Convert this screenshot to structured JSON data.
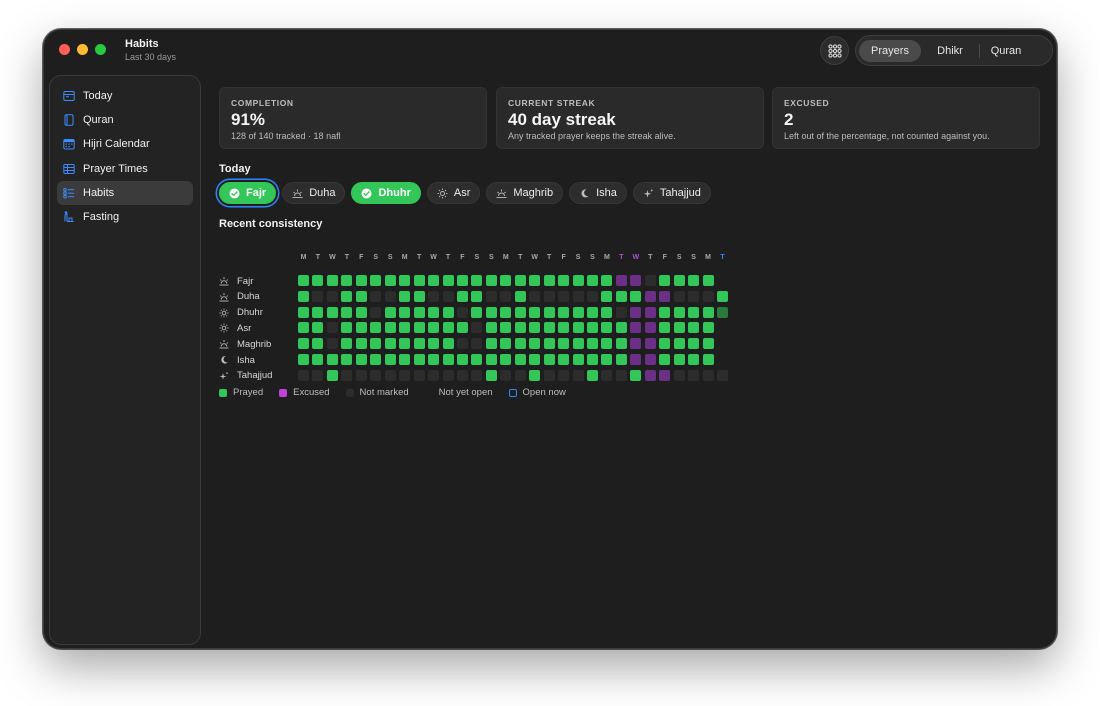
{
  "app": {
    "title": "Habits",
    "subtitle": "Last 30 days"
  },
  "segmented": {
    "items": [
      "Prayers",
      "Dhikr",
      "Quran"
    ],
    "active": "Prayers"
  },
  "sidebar": {
    "items": [
      {
        "label": "Today",
        "icon": "today-icon"
      },
      {
        "label": "Quran",
        "icon": "book-icon"
      },
      {
        "label": "Hijri Calendar",
        "icon": "calendar-icon"
      },
      {
        "label": "Prayer Times",
        "icon": "table-icon"
      },
      {
        "label": "Habits",
        "icon": "checklist-icon",
        "active": true
      },
      {
        "label": "Fasting",
        "icon": "fasting-icon"
      }
    ]
  },
  "cards": [
    {
      "label": "COMPLETION",
      "value": "91%",
      "note": "128 of 140 tracked · 18 nafl"
    },
    {
      "label": "CURRENT STREAK",
      "value": "40 day streak",
      "note": "Any tracked prayer keeps the streak alive."
    },
    {
      "label": "EXCUSED",
      "value": "2",
      "note": "Left out of the percentage, not counted against you."
    }
  ],
  "today": {
    "title": "Today",
    "chips": [
      {
        "label": "Fajr",
        "status": "done",
        "focused": true
      },
      {
        "label": "Duha",
        "status": "open"
      },
      {
        "label": "Dhuhr",
        "status": "done"
      },
      {
        "label": "Asr",
        "status": "open"
      },
      {
        "label": "Maghrib",
        "status": "open"
      },
      {
        "label": "Isha",
        "status": "open"
      },
      {
        "label": "Tahajjud",
        "status": "open"
      }
    ]
  },
  "consistency": {
    "title": "Recent consistency",
    "days": [
      "M",
      "T",
      "W",
      "T",
      "F",
      "S",
      "S",
      "M",
      "T",
      "W",
      "T",
      "F",
      "S",
      "S",
      "M",
      "T",
      "W",
      "T",
      "F",
      "S",
      "S",
      "M",
      "T",
      "W",
      "T",
      "F",
      "S",
      "S",
      "M",
      "T"
    ],
    "day_colors": {
      "22": "#b24fd6",
      "23": "#b24fd6",
      "29": "#2d86ff"
    },
    "status_key": {
      "P": "Prayed",
      "E": "Excused",
      "N": "Not marked",
      "Y": "Not yet open",
      "O": "Open now",
      "D": "Prayed (dimmed)"
    },
    "rows": [
      {
        "name": "Fajr",
        "icon": "sunrise-icon",
        "cells": "PPPPPPPPPPPPPPPPPPPPPPEEN PPPP"
      },
      {
        "name": "Duha",
        "icon": "sunrise-icon",
        "cells": "PNNPPNNPPNNPPNNPNNNNNPPPEENNNPN"
      },
      {
        "name": "Dhuhr",
        "icon": "sun-icon",
        "cells": "PPPPPNPPPPPNPPPPPPPPPPNEEPPPPD"
      },
      {
        "name": "Asr",
        "icon": "sun-icon",
        "cells": "PPNPPPPPPPPPNPPPPPPPPPPEEPPPPY"
      },
      {
        "name": "Maghrib",
        "icon": "sunset-icon",
        "cells": "PPNPPPPPPPPNNPPPPPPPPPPEEPPPPY"
      },
      {
        "name": "Isha",
        "icon": "moon-icon",
        "cells": "PPPPPPPPPPPPPPPPPPPPPPPEEPPPPY"
      },
      {
        "name": "Tahajjud",
        "icon": "sparkle-icon",
        "cells": "NNPNNNNNNNNNNPNNPNNNPNNPEENNNNN"
      }
    ],
    "legend": [
      {
        "label": "Prayed",
        "color": "#33c759"
      },
      {
        "label": "Excused",
        "color": "#c242d8"
      },
      {
        "label": "Not marked",
        "color": "#2c2c2c"
      },
      {
        "label": "Not yet open",
        "color": "#1e1e1e"
      },
      {
        "label": "Open now",
        "color": "#2d86ff"
      }
    ]
  },
  "colors": {
    "prayed": "#33c759",
    "prayed_dim": "#2a7a3d",
    "excused": "#6b2f86",
    "not_marked": "#2c2c2c",
    "accent": "#2d86ff"
  }
}
